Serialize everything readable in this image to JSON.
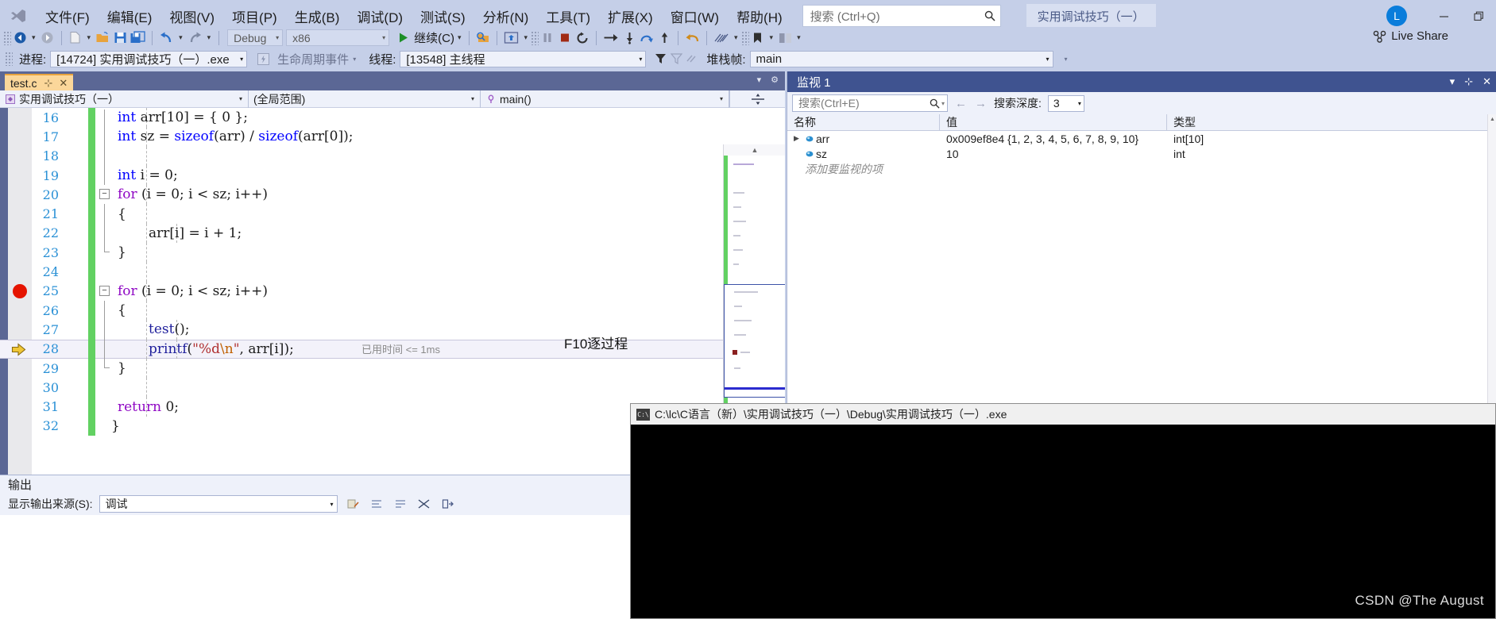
{
  "menu": {
    "logo_icon": "visual-studio-logo",
    "items": [
      {
        "label": "文件(F)",
        "accel": "F"
      },
      {
        "label": "编辑(E)",
        "accel": "E"
      },
      {
        "label": "视图(V)",
        "accel": "V"
      },
      {
        "label": "项目(P)",
        "accel": "P"
      },
      {
        "label": "生成(B)",
        "accel": "B"
      },
      {
        "label": "调试(D)",
        "accel": "D"
      },
      {
        "label": "测试(S)",
        "accel": "S"
      },
      {
        "label": "分析(N)",
        "accel": "N"
      },
      {
        "label": "工具(T)",
        "accel": "T"
      },
      {
        "label": "扩展(X)",
        "accel": "X"
      },
      {
        "label": "窗口(W)",
        "accel": "W"
      },
      {
        "label": "帮助(H)",
        "accel": "H"
      }
    ],
    "search_placeholder": "搜索 (Ctrl+Q)",
    "search_icon": "search-icon",
    "project_pill": "实用调试技巧（一）",
    "avatar_initial": "L",
    "minimize_icon": "minimize-icon",
    "restore_icon": "restore-icon"
  },
  "toolbar": {
    "nav_back_icon": "navigate-back-icon",
    "nav_forward_icon": "navigate-forward-icon",
    "new_file_icon": "new-file-icon",
    "open_file_icon": "open-file-icon",
    "save_icon": "save-icon",
    "save_all_icon": "save-all-icon",
    "undo_icon": "undo-icon",
    "redo_icon": "redo-icon",
    "config_value": "Debug",
    "platform_value": "x86",
    "continue_label": "继续(C)",
    "continue_icon": "play-icon",
    "hot_reload_icon": "hot-reload-icon",
    "snapshot_icon": "snapshot-icon",
    "break_all_icon": "pause-icon",
    "stop_icon": "stop-icon",
    "restart_icon": "restart-icon",
    "show_next_statement_icon": "show-next-statement-icon",
    "step_into_icon": "step-into-icon",
    "step_over_icon": "step-over-icon",
    "step_out_icon": "step-out-icon",
    "undo_step_icon": "step-back-icon",
    "diagnostics_icon": "diagnostics-icon",
    "bookmark_icon": "bookmark-icon",
    "compare_icon": "compare-icon",
    "live_share_label": "Live Share",
    "live_share_icon": "live-share-icon"
  },
  "context_bar": {
    "process_label": "进程:",
    "process_value": "[14724] 实用调试技巧（一）.exe",
    "lifecycle_events_label": "生命周期事件",
    "lifecycle_icon": "lifecycle-icon",
    "thread_label": "线程:",
    "thread_value": "[13548] 主线程",
    "filter_icon": "filter-icon",
    "filter_clear_icon": "filter-clear-icon",
    "flag_icon": "flag-icon",
    "stack_frame_label": "堆栈帧:",
    "stack_frame_value": "main"
  },
  "editor": {
    "tab": {
      "label": "test.c",
      "pin_icon": "pin-icon",
      "close_icon": "close-icon"
    },
    "nav": {
      "project": "实用调试技巧（一）",
      "project_icon": "project-icon",
      "scope": "(全局范围)",
      "member": "main()",
      "member_icon": "method-icon",
      "split_icon": "split-view-icon"
    },
    "annotation": "F10逐过程",
    "first_line_number": 16,
    "lines": [
      {
        "n": 16,
        "indent": 0,
        "text": "int arr[10] = { 0 };"
      },
      {
        "n": 17,
        "indent": 0,
        "text": "int sz = sizeof(arr) / sizeof(arr[0]);"
      },
      {
        "n": 18,
        "indent": 0,
        "text": ""
      },
      {
        "n": 19,
        "indent": 0,
        "text": "int i = 0;"
      },
      {
        "n": 20,
        "indent": 0,
        "text": "for (i = 0; i < sz; i++)"
      },
      {
        "n": 21,
        "indent": 0,
        "text": "{"
      },
      {
        "n": 22,
        "indent": 1,
        "text": "arr[i] = i + 1;"
      },
      {
        "n": 23,
        "indent": 0,
        "text": "}"
      },
      {
        "n": 24,
        "indent": 0,
        "text": ""
      },
      {
        "n": 25,
        "indent": 0,
        "text": "for (i = 0; i < sz; i++)"
      },
      {
        "n": 26,
        "indent": 0,
        "text": "{"
      },
      {
        "n": 27,
        "indent": 1,
        "text": "test();"
      },
      {
        "n": 28,
        "indent": 1,
        "text": "printf(\"%d\\n\", arr[i]);"
      },
      {
        "n": 29,
        "indent": 0,
        "text": "}"
      },
      {
        "n": 30,
        "indent": 0,
        "text": ""
      },
      {
        "n": 31,
        "indent": 0,
        "text": "return 0;"
      },
      {
        "n": 32,
        "indent": 0,
        "text": "}"
      }
    ],
    "breakpoint_line": 25,
    "current_line": 28,
    "elapsed_time": "已用时间 <= 1ms",
    "breakpoint_icon": "breakpoint-icon",
    "current_statement_icon": "current-statement-arrow-icon"
  },
  "watch": {
    "title": "监视 1",
    "dropdown_icon": "chevron-down-icon",
    "pin_icon": "pin-icon",
    "close_icon": "close-icon",
    "search_placeholder": "搜索(Ctrl+E)",
    "search_icon": "search-icon",
    "prev_icon": "arrow-left-icon",
    "next_icon": "arrow-right-icon",
    "depth_label": "搜索深度:",
    "depth_value": "3",
    "columns": [
      "名称",
      "值",
      "类型"
    ],
    "rows": [
      {
        "expander": "▶",
        "icon": "variable-icon",
        "name": "arr",
        "value": "0x009ef8e4 {1, 2, 3, 4, 5, 6, 7, 8, 9, 10}",
        "type": "int[10]"
      },
      {
        "expander": "",
        "icon": "variable-icon",
        "name": "sz",
        "value": "10",
        "type": "int"
      }
    ],
    "add_item_placeholder": "添加要监视的项"
  },
  "console": {
    "title": "C:\\lc\\C语言（新）\\实用调试技巧（一）\\Debug\\实用调试技巧（一）.exe",
    "icon": "console-icon",
    "body_text": "",
    "watermark": "CSDN @The August"
  },
  "output": {
    "title": "输出",
    "source_label": "显示输出来源(S):",
    "source_value": "调试",
    "clear_icon": "clear-output-icon",
    "toggle_wordwrap_icon": "word-wrap-icon",
    "find_icon": "find-icon",
    "scroll_icon": "auto-scroll-icon",
    "go_icon": "go-to-icon",
    "body_text": ""
  },
  "colors": {
    "chrome": "#c5cfe8",
    "panel_header": "#3f5390",
    "editor_tab": "#fbd79a",
    "breakpoint": "#e51400",
    "current_line_arrow": "#e8c13b",
    "changed_line": "#62d162",
    "line_number": "#2b91d6",
    "keyword": "#0000ff",
    "control_keyword": "#8f08c4",
    "string": "#b03030",
    "accent_blue": "#0a7ddb"
  }
}
